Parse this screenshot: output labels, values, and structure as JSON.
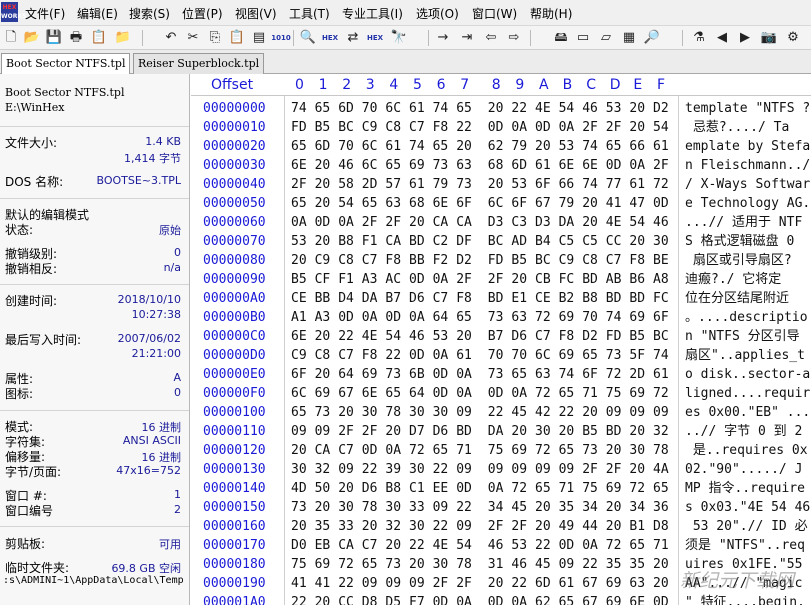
{
  "app": {
    "logo_text": "HEX",
    "logo_sub": "WORKS"
  },
  "menu": [
    "文件(F)",
    "编辑(E)",
    "搜索(S)",
    "位置(P)",
    "视图(V)",
    "工具(T)",
    "专业工具(I)",
    "选项(O)",
    "窗口(W)",
    "帮助(H)"
  ],
  "toolbar": {
    "icons": [
      {
        "name": "new-file-icon",
        "glyph": "🗋"
      },
      {
        "name": "open-file-icon",
        "glyph": "📂"
      },
      {
        "name": "save-icon",
        "glyph": "💾"
      },
      {
        "name": "print-icon",
        "glyph": "🖶"
      },
      {
        "name": "properties-icon",
        "glyph": "📋"
      },
      {
        "name": "open-folder-icon",
        "glyph": "📁"
      },
      {
        "name": "undo-icon",
        "glyph": "↶"
      },
      {
        "name": "cut-icon",
        "glyph": "✂"
      },
      {
        "name": "copy-icon",
        "glyph": "⎘"
      },
      {
        "name": "paste-icon",
        "glyph": "📋"
      },
      {
        "name": "paste-special-icon",
        "glyph": "▤"
      },
      {
        "name": "binary-icon",
        "glyph": "1010"
      },
      {
        "name": "find-icon",
        "glyph": "🔍"
      },
      {
        "name": "find-hex-icon",
        "glyph": "HEX"
      },
      {
        "name": "replace-icon",
        "glyph": "⇄"
      },
      {
        "name": "replace-hex-icon",
        "glyph": "HEX"
      },
      {
        "name": "find-again-icon",
        "glyph": "🔭"
      },
      {
        "name": "goto-offset-icon",
        "glyph": "→"
      },
      {
        "name": "goto-sector-icon",
        "glyph": "⇥"
      },
      {
        "name": "back-icon",
        "glyph": "⇦"
      },
      {
        "name": "forward-icon",
        "glyph": "⇨"
      },
      {
        "name": "disk-editor-icon",
        "glyph": "🖴"
      },
      {
        "name": "ram-editor-icon",
        "glyph": "▭"
      },
      {
        "name": "media-icon",
        "glyph": "▱"
      },
      {
        "name": "calculator-icon",
        "glyph": "▦"
      },
      {
        "name": "zoom-icon",
        "glyph": "🔎"
      },
      {
        "name": "data-interpreter-icon",
        "glyph": "⚗"
      },
      {
        "name": "previous-icon",
        "glyph": "◀"
      },
      {
        "name": "next-icon",
        "glyph": "▶"
      },
      {
        "name": "snapshot-icon",
        "glyph": "📷"
      },
      {
        "name": "settings-icon",
        "glyph": "⚙"
      }
    ]
  },
  "tabs": [
    {
      "label": "Boot Sector NTFS.tpl",
      "active": true
    },
    {
      "label": "Reiser Superblock.tpl",
      "active": false
    }
  ],
  "info": {
    "filename": "Boot Sector NTFS.tpl",
    "path": "E:\\WinHex",
    "file_size_label": "文件大小:",
    "file_size_kb": "1.4 KB",
    "file_size_bytes": "1,414 字节",
    "dos_name_label": "DOS 名称:",
    "dos_name": "BOOTSE~3.TPL",
    "edit_mode_label": "默认的编辑模式",
    "state_label": "状态:",
    "state_value": "原始",
    "undo_level_label": "撤销级别:",
    "undo_level_value": "0",
    "undo_reverse_label": "撤销相反:",
    "undo_reverse_value": "n/a",
    "created_label": "创建时间:",
    "created_date": "2018/10/10",
    "created_time": "10:27:38",
    "modified_label": "最后写入时间:",
    "modified_date": "2007/06/02",
    "modified_time": "21:21:00",
    "attr_label": "属性:",
    "attr_value": "A",
    "icon_label": "图标:",
    "icon_value": "0",
    "mode_label": "模式:",
    "mode_value": "16 进制",
    "charset_label": "字符集:",
    "charset_value": "ANSI ASCII",
    "offset_label": "偏移量:",
    "offset_value": "16 进制",
    "bytes_page_label": "字节/页面:",
    "bytes_page_value": "47x16=752",
    "window_num_label": "窗口 #:",
    "window_num_value": "1",
    "window_id_label": "窗口编号",
    "window_id_value": "2",
    "clipboard_label": "剪贴板:",
    "clipboard_value": "可用",
    "temp_label": "临时文件夹:",
    "temp_value": "69.8 GB 空闲",
    "temp_path": ":s\\ADMINI~1\\AppData\\Local\\Temp"
  },
  "hex": {
    "offset_header": "Offset",
    "columns": [
      "0",
      "1",
      "2",
      "3",
      "4",
      "5",
      "6",
      "7",
      "8",
      "9",
      "A",
      "B",
      "C",
      "D",
      "E",
      "F"
    ],
    "rows": [
      {
        "offset": "00000000",
        "bytes": "74 65 6D 70 6C 61 74 65 20 22 4E 54 46 53 20 D2",
        "text": "template \"NTFS ?"
      },
      {
        "offset": "00000010",
        "bytes": "FD B5 BC C9 C8 C7 F8 22 0D 0A 0D 0A 2F 2F 20 54",
        "text": " 忌惹?..../ Ta"
      },
      {
        "offset": "00000020",
        "bytes": "65 6D 70 6C 61 74 65 20 62 79 20 53 74 65 66 61",
        "text": "emplate by Stefa"
      },
      {
        "offset": "00000030",
        "bytes": "6E 20 46 6C 65 69 73 63 68 6D 61 6E 6E 0D 0A 2F",
        "text": "n Fleischmann../"
      },
      {
        "offset": "00000040",
        "bytes": "2F 20 58 2D 57 61 79 73 20 53 6F 66 74 77 61 72",
        "text": "/ X-Ways Softwar"
      },
      {
        "offset": "00000050",
        "bytes": "65 20 54 65 63 68 6E 6F 6C 6F 67 79 20 41 47 0D",
        "text": "e Technology AG."
      },
      {
        "offset": "00000060",
        "bytes": "0A 0D 0A 2F 2F 20 CA CA D3 C3 D3 DA 20 4E 54 46",
        "text": "...// 适用于 NTF"
      },
      {
        "offset": "00000070",
        "bytes": "53 20 B8 F1 CA BD C2 DF BC AD B4 C5 C5 CC 20 30",
        "text": "S 格式逻辑磁盘 0"
      },
      {
        "offset": "00000080",
        "bytes": "20 C9 C8 C7 F8 BB F2 D2 FD B5 BC C9 C8 C7 F8 BE",
        "text": " 扇区或引导扇区?"
      },
      {
        "offset": "00000090",
        "bytes": "B5 CF F1 A3 AC 0D 0A 2F 2F 20 CB FC BD AB B6 A8",
        "text": "迪瘢?./ 它将定"
      },
      {
        "offset": "000000A0",
        "bytes": "CE BB D4 DA B7 D6 C7 F8 BD E1 CE B2 B8 BD BD FC",
        "text": "位在分区结尾附近"
      },
      {
        "offset": "000000B0",
        "bytes": "A1 A3 0D 0A 0D 0A 64 65 73 63 72 69 70 74 69 6F",
        "text": "。....descriptio"
      },
      {
        "offset": "000000C0",
        "bytes": "6E 20 22 4E 54 46 53 20 B7 D6 C7 F8 D2 FD B5 BC",
        "text": "n \"NTFS 分区引导"
      },
      {
        "offset": "000000D0",
        "bytes": "C9 C8 C7 F8 22 0D 0A 61 70 70 6C 69 65 73 5F 74",
        "text": "扇区\"..applies_t"
      },
      {
        "offset": "000000E0",
        "bytes": "6F 20 64 69 73 6B 0D 0A 73 65 63 74 6F 72 2D 61",
        "text": "o disk..sector-a"
      },
      {
        "offset": "000000F0",
        "bytes": "6C 69 67 6E 65 64 0D 0A 0D 0A 72 65 71 75 69 72",
        "text": "ligned....requir"
      },
      {
        "offset": "00000100",
        "bytes": "65 73 20 30 78 30 30 09 22 45 42 22 20 09 09 09",
        "text": "es 0x00.\"EB\" ..."
      },
      {
        "offset": "00000110",
        "bytes": "09 09 2F 2F 20 D7 D6 BD DA 20 30 20 B5 BD 20 32",
        "text": "..// 字节 0 到 2"
      },
      {
        "offset": "00000120",
        "bytes": "20 CA C7 0D 0A 72 65 71 75 69 72 65 73 20 30 78",
        "text": " 是..requires 0x"
      },
      {
        "offset": "00000130",
        "bytes": "30 32 09 22 39 30 22 09 09 09 09 09 2F 2F 20 4A",
        "text": "02.\"90\"...../ J"
      },
      {
        "offset": "00000140",
        "bytes": "4D 50 20 D6 B8 C1 EE 0D 0A 72 65 71 75 69 72 65",
        "text": "MP 指令..require"
      },
      {
        "offset": "00000150",
        "bytes": "73 20 30 78 30 33 09 22 34 45 20 35 34 20 34 36",
        "text": "s 0x03.\"4E 54 46"
      },
      {
        "offset": "00000160",
        "bytes": "20 35 33 20 32 30 22 09 2F 2F 20 49 44 20 B1 D8",
        "text": " 53 20\".// ID 必"
      },
      {
        "offset": "00000170",
        "bytes": "D0 EB CA C7 20 22 4E 54 46 53 22 0D 0A 72 65 71",
        "text": "须是 \"NTFS\"..req"
      },
      {
        "offset": "00000180",
        "bytes": "75 69 72 65 73 20 30 78 31 46 45 09 22 35 35 20",
        "text": "uires 0x1FE.\"55 "
      },
      {
        "offset": "00000190",
        "bytes": "41 41 22 09 09 09 2F 2F 20 22 6D 61 67 69 63 20",
        "text": "AA\"...// \"magic "
      },
      {
        "offset": "000001A0",
        "bytes": "22 20 CC D8 D5 F7 0D 0A 0D 0A 62 65 67 69 6E 0D",
        "text": "\" 特征....begin."
      }
    ]
  },
  "watermark": "新纪元下载网"
}
